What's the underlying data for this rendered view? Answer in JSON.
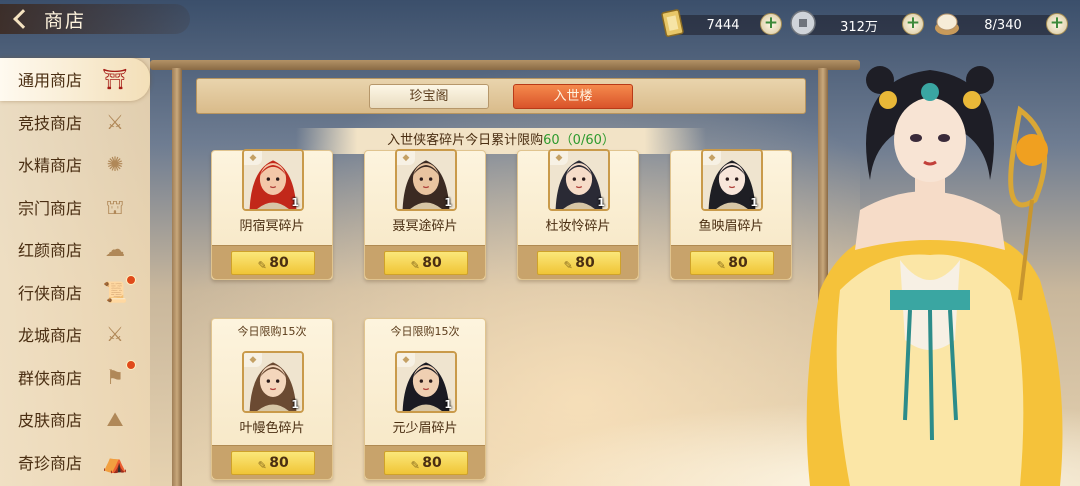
{
  "header": {
    "title": "商店"
  },
  "currencies": [
    {
      "icon": "token-icon",
      "value": "7444"
    },
    {
      "icon": "coin-icon",
      "value": "312万"
    },
    {
      "icon": "bun-icon",
      "value": "8/340"
    }
  ],
  "sidebar": {
    "items": [
      {
        "label": "通用商店",
        "icon": "pavilion-icon",
        "active": true
      },
      {
        "label": "竞技商店",
        "icon": "crossed-swords-icon"
      },
      {
        "label": "水精商店",
        "icon": "crystal-icon"
      },
      {
        "label": "宗门商店",
        "icon": "gate-icon"
      },
      {
        "label": "红颜商店",
        "icon": "fan-icon"
      },
      {
        "label": "行侠商店",
        "icon": "scroll-icon",
        "badge": true
      },
      {
        "label": "龙城商店",
        "icon": "crossed-swords-icon"
      },
      {
        "label": "群侠商店",
        "icon": "banner-icon",
        "badge": true
      },
      {
        "label": "皮肤商店",
        "icon": "mountain-icon"
      },
      {
        "label": "奇珍商店",
        "icon": "treasure-icon"
      }
    ]
  },
  "tabs": [
    {
      "label": "珍宝阁",
      "active": false
    },
    {
      "label": "入世楼",
      "active": true
    }
  ],
  "notice": {
    "text": "入世侠客碎片今日累计限购",
    "limit": "60",
    "progress": "（0/60）"
  },
  "items": [
    {
      "name": "阴宿冥碎片",
      "price": "80",
      "qty": "1",
      "limit": "",
      "hair": "#c2281a",
      "skin": "#f3c7a8"
    },
    {
      "name": "聂冥途碎片",
      "price": "80",
      "qty": "1",
      "limit": "",
      "hair": "#3b2a22",
      "skin": "#e9c4a0"
    },
    {
      "name": "杜妆怜碎片",
      "price": "80",
      "qty": "1",
      "limit": "",
      "hair": "#2a2a35",
      "skin": "#f6dcc8"
    },
    {
      "name": "鱼映眉碎片",
      "price": "80",
      "qty": "1",
      "limit": "",
      "hair": "#1e1e24",
      "skin": "#f8e6da"
    },
    {
      "name": "叶幔色碎片",
      "price": "80",
      "qty": "1",
      "limit": "今日限购15次",
      "hair": "#6b4a32",
      "skin": "#f4d6bc"
    },
    {
      "name": "元少眉碎片",
      "price": "80",
      "qty": "1",
      "limit": "今日限购15次",
      "hair": "#1a1a22",
      "skin": "#efcfb2"
    }
  ],
  "colors": {
    "accent": "#d9532a",
    "gold": "#f0c536",
    "green": "#2d9a2d"
  }
}
